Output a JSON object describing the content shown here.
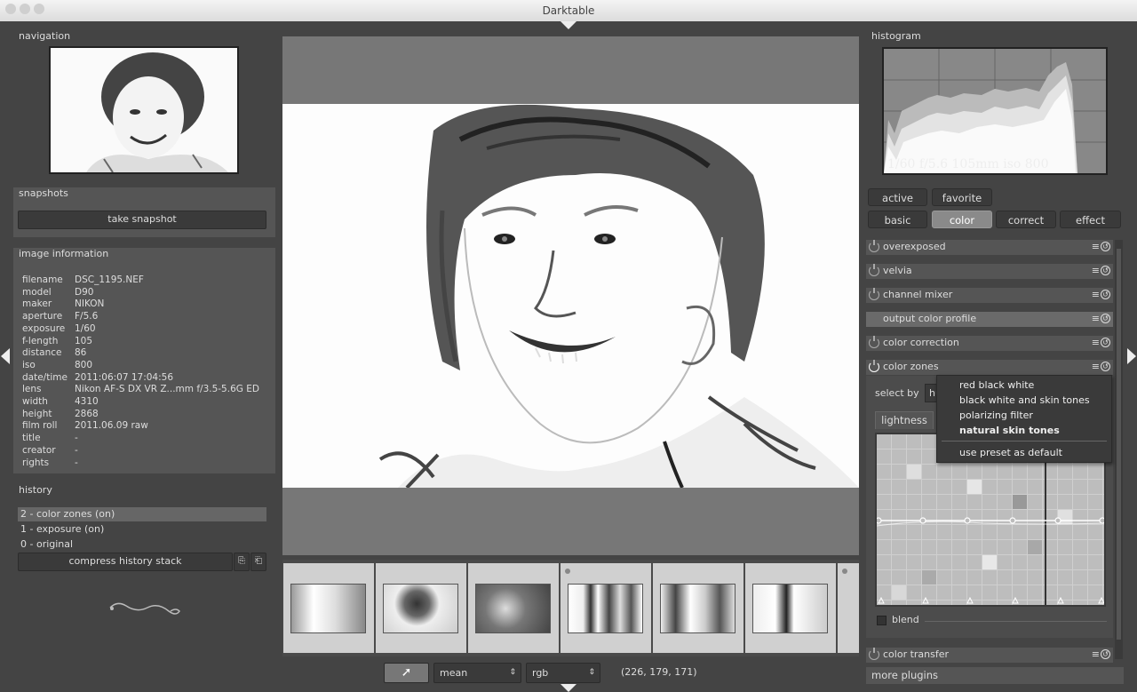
{
  "window": {
    "title": "Darktable"
  },
  "left": {
    "navigation_title": "navigation",
    "snapshots_title": "snapshots",
    "take_snapshot": "take snapshot",
    "image_info_title": "image information",
    "info": [
      {
        "k": "filename",
        "v": "DSC_1195.NEF"
      },
      {
        "k": "model",
        "v": "D90"
      },
      {
        "k": "maker",
        "v": "NIKON"
      },
      {
        "k": "aperture",
        "v": "F/5.6"
      },
      {
        "k": "exposure",
        "v": "1/60"
      },
      {
        "k": "f-length",
        "v": "105"
      },
      {
        "k": "distance",
        "v": "86"
      },
      {
        "k": "iso",
        "v": "800"
      },
      {
        "k": "date/time",
        "v": "2011:06:07 17:04:56"
      },
      {
        "k": "lens",
        "v": "Nikon AF-S DX VR Z...mm f/3.5-5.6G ED"
      },
      {
        "k": "width",
        "v": "4310"
      },
      {
        "k": "height",
        "v": "2868"
      },
      {
        "k": "film roll",
        "v": "2011.06.09 raw"
      },
      {
        "k": "title",
        "v": "-"
      },
      {
        "k": "creator",
        "v": "-"
      },
      {
        "k": "rights",
        "v": "-"
      }
    ],
    "history_title": "history",
    "history": [
      {
        "label": "2 - color zones (on)",
        "selected": true
      },
      {
        "label": "1 - exposure (on)",
        "selected": false
      },
      {
        "label": "0 - original",
        "selected": false
      }
    ],
    "compress": "compress history stack"
  },
  "right": {
    "histogram_title": "histogram",
    "exif_overlay": "1/60 f/5.6 105mm iso 800",
    "groups_row1": [
      {
        "label": "active",
        "on": false
      },
      {
        "label": "favorite",
        "on": false
      }
    ],
    "groups_row2": [
      {
        "label": "basic",
        "on": false
      },
      {
        "label": "color",
        "on": true
      },
      {
        "label": "correct",
        "on": false
      },
      {
        "label": "effect",
        "on": false
      }
    ],
    "modules": [
      "overexposed",
      "velvia",
      "channel mixer",
      "output color profile",
      "color correction"
    ],
    "color_zones": "color zones",
    "select_by": "select by",
    "select_by_value": "hu",
    "tab_lightness": "lightness",
    "blend": "blend",
    "color_transfer": "color transfer",
    "more_plugins": "more plugins",
    "presets": [
      {
        "label": "red black white",
        "bold": false
      },
      {
        "label": "black white and skin tones",
        "bold": false
      },
      {
        "label": "polarizing filter",
        "bold": false
      },
      {
        "label": "natural skin tones",
        "bold": true
      }
    ],
    "preset_default": "use preset as default",
    "menu_icon": "≡",
    "reset_icon": "⊙"
  },
  "bottom": {
    "mode1": "mean",
    "mode2": "rgb",
    "readout": "(226, 179, 171)"
  }
}
